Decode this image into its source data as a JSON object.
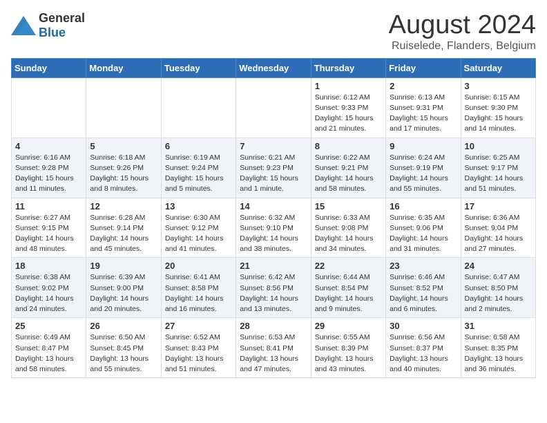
{
  "logo": {
    "text_general": "General",
    "text_blue": "Blue"
  },
  "title": "August 2024",
  "subtitle": "Ruiselede, Flanders, Belgium",
  "headers": [
    "Sunday",
    "Monday",
    "Tuesday",
    "Wednesday",
    "Thursday",
    "Friday",
    "Saturday"
  ],
  "weeks": [
    [
      {
        "day": "",
        "info": ""
      },
      {
        "day": "",
        "info": ""
      },
      {
        "day": "",
        "info": ""
      },
      {
        "day": "",
        "info": ""
      },
      {
        "day": "1",
        "info": "Sunrise: 6:12 AM\nSunset: 9:33 PM\nDaylight: 15 hours\nand 21 minutes."
      },
      {
        "day": "2",
        "info": "Sunrise: 6:13 AM\nSunset: 9:31 PM\nDaylight: 15 hours\nand 17 minutes."
      },
      {
        "day": "3",
        "info": "Sunrise: 6:15 AM\nSunset: 9:30 PM\nDaylight: 15 hours\nand 14 minutes."
      }
    ],
    [
      {
        "day": "4",
        "info": "Sunrise: 6:16 AM\nSunset: 9:28 PM\nDaylight: 15 hours\nand 11 minutes."
      },
      {
        "day": "5",
        "info": "Sunrise: 6:18 AM\nSunset: 9:26 PM\nDaylight: 15 hours\nand 8 minutes."
      },
      {
        "day": "6",
        "info": "Sunrise: 6:19 AM\nSunset: 9:24 PM\nDaylight: 15 hours\nand 5 minutes."
      },
      {
        "day": "7",
        "info": "Sunrise: 6:21 AM\nSunset: 9:23 PM\nDaylight: 15 hours\nand 1 minute."
      },
      {
        "day": "8",
        "info": "Sunrise: 6:22 AM\nSunset: 9:21 PM\nDaylight: 14 hours\nand 58 minutes."
      },
      {
        "day": "9",
        "info": "Sunrise: 6:24 AM\nSunset: 9:19 PM\nDaylight: 14 hours\nand 55 minutes."
      },
      {
        "day": "10",
        "info": "Sunrise: 6:25 AM\nSunset: 9:17 PM\nDaylight: 14 hours\nand 51 minutes."
      }
    ],
    [
      {
        "day": "11",
        "info": "Sunrise: 6:27 AM\nSunset: 9:15 PM\nDaylight: 14 hours\nand 48 minutes."
      },
      {
        "day": "12",
        "info": "Sunrise: 6:28 AM\nSunset: 9:14 PM\nDaylight: 14 hours\nand 45 minutes."
      },
      {
        "day": "13",
        "info": "Sunrise: 6:30 AM\nSunset: 9:12 PM\nDaylight: 14 hours\nand 41 minutes."
      },
      {
        "day": "14",
        "info": "Sunrise: 6:32 AM\nSunset: 9:10 PM\nDaylight: 14 hours\nand 38 minutes."
      },
      {
        "day": "15",
        "info": "Sunrise: 6:33 AM\nSunset: 9:08 PM\nDaylight: 14 hours\nand 34 minutes."
      },
      {
        "day": "16",
        "info": "Sunrise: 6:35 AM\nSunset: 9:06 PM\nDaylight: 14 hours\nand 31 minutes."
      },
      {
        "day": "17",
        "info": "Sunrise: 6:36 AM\nSunset: 9:04 PM\nDaylight: 14 hours\nand 27 minutes."
      }
    ],
    [
      {
        "day": "18",
        "info": "Sunrise: 6:38 AM\nSunset: 9:02 PM\nDaylight: 14 hours\nand 24 minutes."
      },
      {
        "day": "19",
        "info": "Sunrise: 6:39 AM\nSunset: 9:00 PM\nDaylight: 14 hours\nand 20 minutes."
      },
      {
        "day": "20",
        "info": "Sunrise: 6:41 AM\nSunset: 8:58 PM\nDaylight: 14 hours\nand 16 minutes."
      },
      {
        "day": "21",
        "info": "Sunrise: 6:42 AM\nSunset: 8:56 PM\nDaylight: 14 hours\nand 13 minutes."
      },
      {
        "day": "22",
        "info": "Sunrise: 6:44 AM\nSunset: 8:54 PM\nDaylight: 14 hours\nand 9 minutes."
      },
      {
        "day": "23",
        "info": "Sunrise: 6:46 AM\nSunset: 8:52 PM\nDaylight: 14 hours\nand 6 minutes."
      },
      {
        "day": "24",
        "info": "Sunrise: 6:47 AM\nSunset: 8:50 PM\nDaylight: 14 hours\nand 2 minutes."
      }
    ],
    [
      {
        "day": "25",
        "info": "Sunrise: 6:49 AM\nSunset: 8:47 PM\nDaylight: 13 hours\nand 58 minutes."
      },
      {
        "day": "26",
        "info": "Sunrise: 6:50 AM\nSunset: 8:45 PM\nDaylight: 13 hours\nand 55 minutes."
      },
      {
        "day": "27",
        "info": "Sunrise: 6:52 AM\nSunset: 8:43 PM\nDaylight: 13 hours\nand 51 minutes."
      },
      {
        "day": "28",
        "info": "Sunrise: 6:53 AM\nSunset: 8:41 PM\nDaylight: 13 hours\nand 47 minutes."
      },
      {
        "day": "29",
        "info": "Sunrise: 6:55 AM\nSunset: 8:39 PM\nDaylight: 13 hours\nand 43 minutes."
      },
      {
        "day": "30",
        "info": "Sunrise: 6:56 AM\nSunset: 8:37 PM\nDaylight: 13 hours\nand 40 minutes."
      },
      {
        "day": "31",
        "info": "Sunrise: 6:58 AM\nSunset: 8:35 PM\nDaylight: 13 hours\nand 36 minutes."
      }
    ]
  ]
}
